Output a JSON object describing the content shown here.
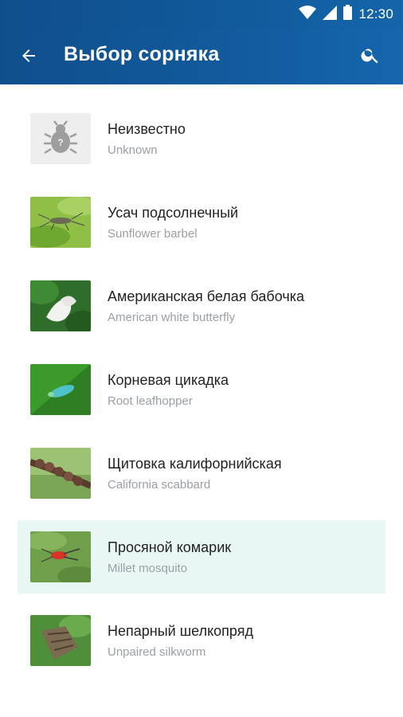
{
  "status_bar": {
    "time": "12:30",
    "icons": [
      "wifi-icon",
      "signal-icon",
      "battery-icon"
    ]
  },
  "app_bar": {
    "title": "Выбор сорняка",
    "back_icon": "arrow-back-icon",
    "search_icon": "search-icon"
  },
  "colors": {
    "primary": "#115a9c",
    "selected_row": "#e9f7f4",
    "subtitle": "#9aa0a6"
  },
  "items": [
    {
      "name": "Неизвестно",
      "subtitle": "Unknown",
      "selected": false
    },
    {
      "name": "Усач подсолнечный",
      "subtitle": "Sunflower barbel",
      "selected": false
    },
    {
      "name": "Американская белая бабочка",
      "subtitle": "American white butterfly",
      "selected": false
    },
    {
      "name": "Корневая цикадка",
      "subtitle": "Root leafhopper",
      "selected": false
    },
    {
      "name": "Щитовка калифорнийская",
      "subtitle": "California scabbard",
      "selected": false
    },
    {
      "name": "Просяной комарик",
      "subtitle": "Millet mosquito",
      "selected": true
    },
    {
      "name": "Непарный шелкопряд",
      "subtitle": "Unpaired silkworm",
      "selected": false
    }
  ]
}
